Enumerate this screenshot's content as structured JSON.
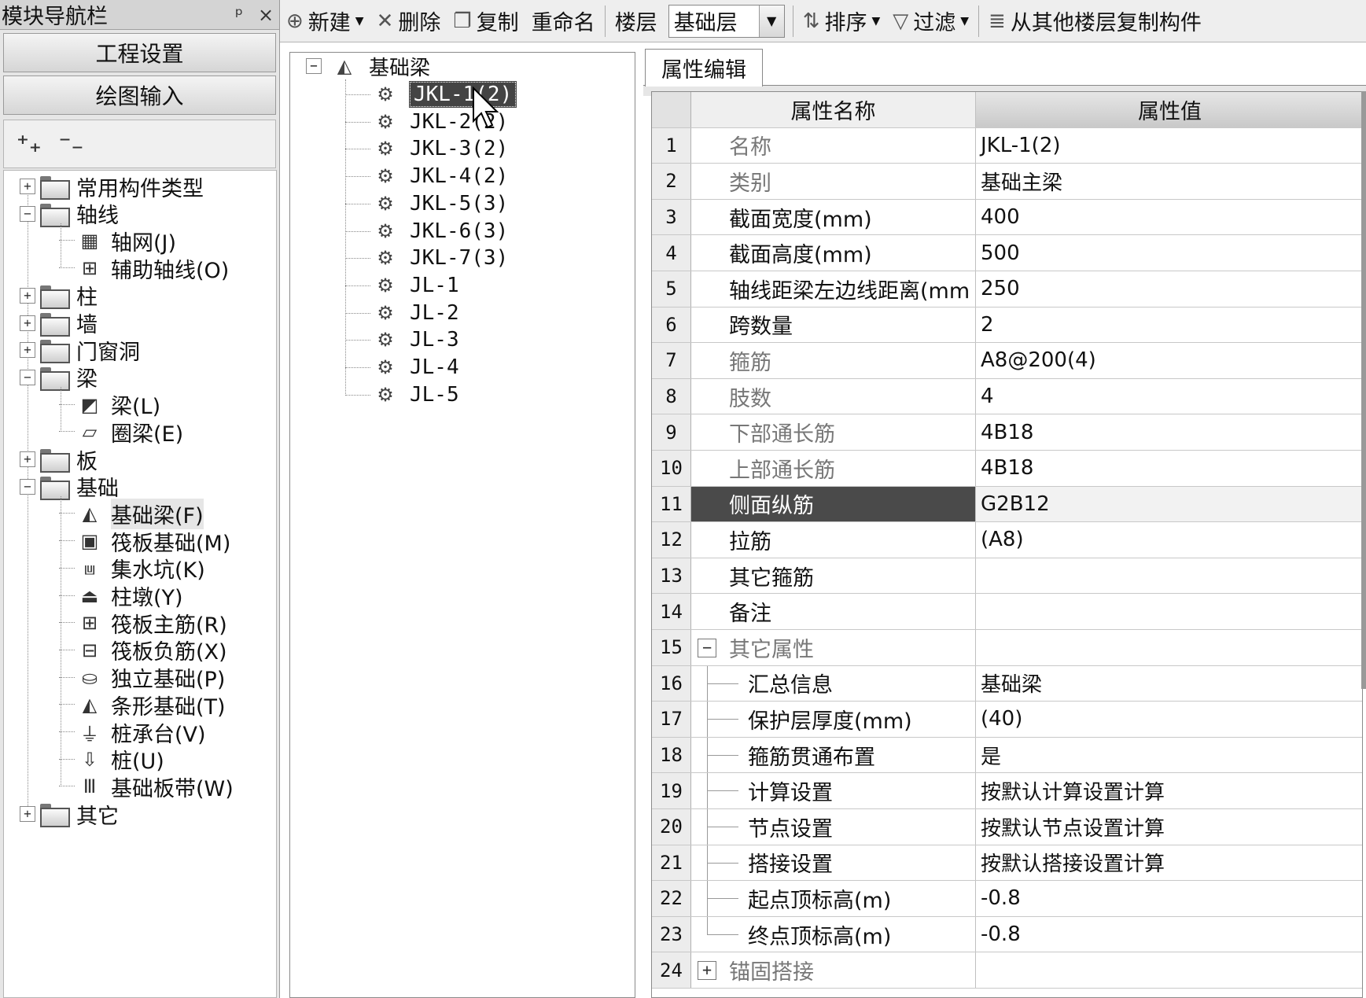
{
  "nav": {
    "title": "模块导航栏",
    "pin": "ᵖ",
    "close": "×",
    "btn_project": "工程设置",
    "btn_draw": "绘图输入",
    "tool_expand": "⁺₊",
    "tool_collapse": "⁻₋",
    "tree": [
      {
        "label": "常用构件类型",
        "type": "folder",
        "exp": "+"
      },
      {
        "label": "轴线",
        "type": "folder",
        "exp": "−"
      },
      {
        "label": "轴网(J)",
        "type": "item",
        "icon": "grid-icon",
        "glyph": "▦"
      },
      {
        "label": "辅助轴线(O)",
        "type": "item",
        "icon": "aux-axis-icon",
        "glyph": "⊞"
      },
      {
        "label": "柱",
        "type": "folder",
        "exp": "+"
      },
      {
        "label": "墙",
        "type": "folder",
        "exp": "+"
      },
      {
        "label": "门窗洞",
        "type": "folder",
        "exp": "+"
      },
      {
        "label": "梁",
        "type": "folder",
        "exp": "−"
      },
      {
        "label": "梁(L)",
        "type": "item",
        "icon": "beam-icon",
        "glyph": "◩"
      },
      {
        "label": "圈梁(E)",
        "type": "item",
        "icon": "ring-beam-icon",
        "glyph": "▱"
      },
      {
        "label": "板",
        "type": "folder",
        "exp": "+"
      },
      {
        "label": "基础",
        "type": "folder",
        "exp": "−"
      },
      {
        "label": "基础梁(F)",
        "type": "item",
        "icon": "foundation-beam-icon",
        "glyph": "◭",
        "selected": true
      },
      {
        "label": "筏板基础(M)",
        "type": "item",
        "icon": "raft-foundation-icon",
        "glyph": "▣"
      },
      {
        "label": "集水坑(K)",
        "type": "item",
        "icon": "sump-icon",
        "glyph": "⩏"
      },
      {
        "label": "柱墩(Y)",
        "type": "item",
        "icon": "column-pier-icon",
        "glyph": "⏏"
      },
      {
        "label": "筏板主筋(R)",
        "type": "item",
        "icon": "raft-main-rebar-icon",
        "glyph": "⊞"
      },
      {
        "label": "筏板负筋(X)",
        "type": "item",
        "icon": "raft-neg-rebar-icon",
        "glyph": "⊟"
      },
      {
        "label": "独立基础(P)",
        "type": "item",
        "icon": "isolated-footing-icon",
        "glyph": "⛀"
      },
      {
        "label": "条形基础(T)",
        "type": "item",
        "icon": "strip-footing-icon",
        "glyph": "◭"
      },
      {
        "label": "桩承台(V)",
        "type": "item",
        "icon": "pile-cap-icon",
        "glyph": "⏚"
      },
      {
        "label": "桩(U)",
        "type": "item",
        "icon": "pile-icon",
        "glyph": "⇩"
      },
      {
        "label": "基础板带(W)",
        "type": "item",
        "icon": "foundation-strip-icon",
        "glyph": "Ⅲ"
      },
      {
        "label": "其它",
        "type": "folder",
        "exp": "+"
      }
    ]
  },
  "toolbar": {
    "new": "新建",
    "delete": "删除",
    "copy": "复制",
    "rename": "重命名",
    "floor_label": "楼层",
    "floor_value": "基础层",
    "sort": "排序",
    "filter": "过滤",
    "copy_from_floor": "从其他楼层复制构件"
  },
  "components": {
    "root": "基础梁",
    "root_exp": "−",
    "items": [
      "JKL-1(2)",
      "JKL-2(2)",
      "JKL-3(2)",
      "JKL-4(2)",
      "JKL-5(3)",
      "JKL-6(3)",
      "JKL-7(3)",
      "JL-1",
      "JL-2",
      "JL-3",
      "JL-4",
      "JL-5"
    ],
    "selected_index": 0
  },
  "properties": {
    "tab": "属性编辑",
    "col_name": "属性名称",
    "col_value": "属性值",
    "rows": [
      {
        "n": "1",
        "name": "名称",
        "value": "JKL-1(2)",
        "muted": true
      },
      {
        "n": "2",
        "name": "类别",
        "value": "基础主梁",
        "muted": true
      },
      {
        "n": "3",
        "name": "截面宽度(mm)",
        "value": "400"
      },
      {
        "n": "4",
        "name": "截面高度(mm)",
        "value": "500"
      },
      {
        "n": "5",
        "name": "轴线距梁左边线距离(mm",
        "value": "250"
      },
      {
        "n": "6",
        "name": "跨数量",
        "value": "2"
      },
      {
        "n": "7",
        "name": "箍筋",
        "value": "A8@200(4)",
        "muted": true
      },
      {
        "n": "8",
        "name": "肢数",
        "value": "4",
        "muted": true
      },
      {
        "n": "9",
        "name": "下部通长筋",
        "value": "4B18",
        "muted": true
      },
      {
        "n": "10",
        "name": "上部通长筋",
        "value": "4B18",
        "muted": true
      },
      {
        "n": "11",
        "name": "侧面纵筋",
        "value": "G2B12",
        "highlight": true
      },
      {
        "n": "12",
        "name": "拉筋",
        "value": "(A8)"
      },
      {
        "n": "13",
        "name": "其它箍筋",
        "value": ""
      },
      {
        "n": "14",
        "name": "备注",
        "value": ""
      },
      {
        "n": "15",
        "name": "其它属性",
        "value": "",
        "group": "−",
        "muted": true
      },
      {
        "n": "16",
        "name": "汇总信息",
        "value": "基础梁",
        "child": true
      },
      {
        "n": "17",
        "name": "保护层厚度(mm)",
        "value": "(40)",
        "child": true
      },
      {
        "n": "18",
        "name": "箍筋贯通布置",
        "value": "是",
        "child": true
      },
      {
        "n": "19",
        "name": "计算设置",
        "value": "按默认计算设置计算",
        "child": true
      },
      {
        "n": "20",
        "name": "节点设置",
        "value": "按默认节点设置计算",
        "child": true
      },
      {
        "n": "21",
        "name": "搭接设置",
        "value": "按默认搭接设置计算",
        "child": true
      },
      {
        "n": "22",
        "name": "起点顶标高(m)",
        "value": "-0.8",
        "child": true
      },
      {
        "n": "23",
        "name": "终点顶标高(m)",
        "value": "-0.8",
        "child": true,
        "last": true
      },
      {
        "n": "24",
        "name": "锚固搭接",
        "value": "",
        "group": "+",
        "muted": true
      }
    ]
  }
}
